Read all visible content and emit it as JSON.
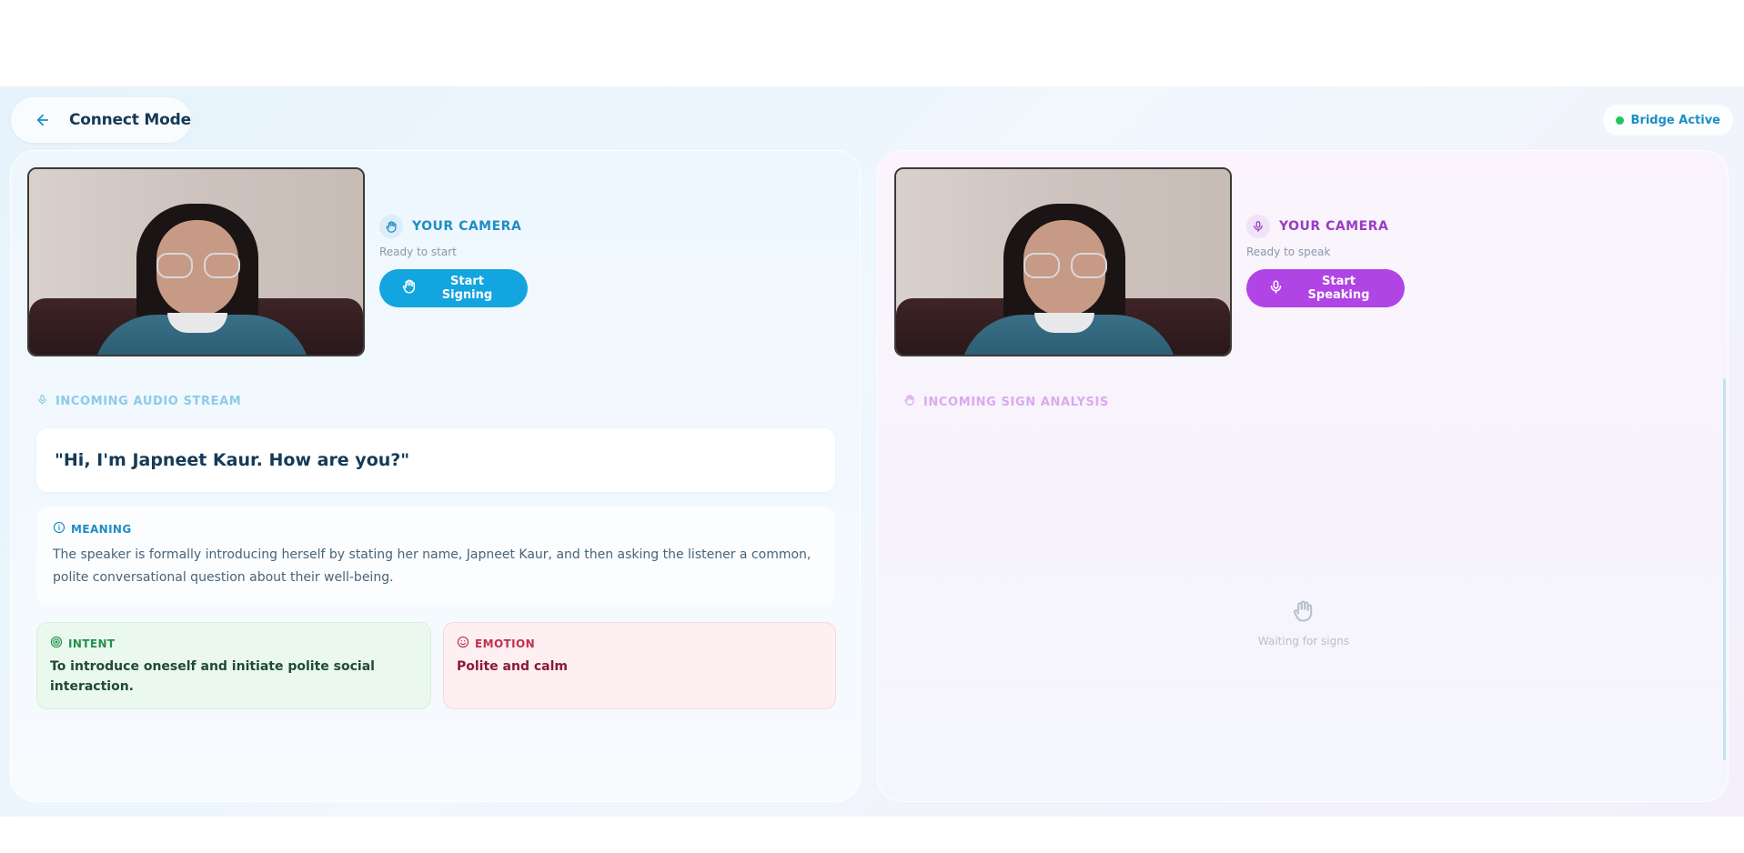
{
  "header": {
    "title": "Connect Mode",
    "status": "Bridge Active"
  },
  "left_panel": {
    "camera_label": "YOUR CAMERA",
    "camera_status": "Ready to start",
    "button_label": "Start Signing",
    "stream_label": "INCOMING AUDIO STREAM",
    "quote": "\"Hi, I'm Japneet Kaur. How are you?\"",
    "meaning": {
      "label": "MEANING",
      "text": "The speaker is formally introducing herself by stating her name, Japneet Kaur, and then asking the listener a common, polite conversational question about their well-being."
    },
    "intent": {
      "label": "INTENT",
      "text": "To introduce oneself and initiate polite social interaction."
    },
    "emotion": {
      "label": "EMOTION",
      "text": "Polite and calm"
    }
  },
  "right_panel": {
    "camera_label": "YOUR CAMERA",
    "camera_status": "Ready to speak",
    "button_label": "Start Speaking",
    "stream_label": "INCOMING SIGN ANALYSIS",
    "empty_state": "Waiting for signs"
  },
  "colors": {
    "accent_blue": "#13a5e0",
    "accent_purple": "#b044e4",
    "status_green": "#22c55e"
  },
  "icons": {
    "back": "arrow-left-icon",
    "hand": "hand-icon",
    "mic": "microphone-icon",
    "info": "info-icon",
    "target": "target-icon",
    "smile": "smile-icon"
  }
}
